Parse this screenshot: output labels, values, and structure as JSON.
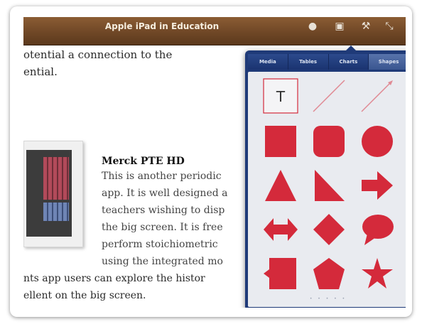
{
  "window": {
    "title": "Apple iPad in Education"
  },
  "toolbar": {
    "icons": [
      "info-icon",
      "media-icon",
      "wrench-icon",
      "expand-icon"
    ],
    "info_glyph": "●",
    "media_glyph": "▣",
    "wrench_glyph": "⚒",
    "expand_glyph": "⤡"
  },
  "document": {
    "lines_top": [
      "otential a connection to the",
      "ential."
    ],
    "heading": "Merck PTE HD",
    "paragraph": [
      "This is another periodic",
      "app. It is well designed a",
      "teachers wishing to disp",
      "the big screen. It is free",
      "perform stoichiometric",
      "using the integrated mo"
    ],
    "lines_bottom": [
      "nts app users can explore the histor",
      "ellent on the big screen."
    ]
  },
  "popover": {
    "tabs": [
      "Media",
      "Tables",
      "Charts",
      "Shapes"
    ],
    "active_tab": "Shapes",
    "shape_color": "#d42a3b",
    "text_tool_label": "T",
    "shapes": [
      "text-box",
      "line",
      "arrow-line",
      "square",
      "rounded-square",
      "circle",
      "triangle",
      "right-triangle",
      "arrow",
      "double-arrow",
      "diamond",
      "speech-bubble",
      "callout",
      "pentagon",
      "star"
    ],
    "page_dots": "• • • • •"
  }
}
